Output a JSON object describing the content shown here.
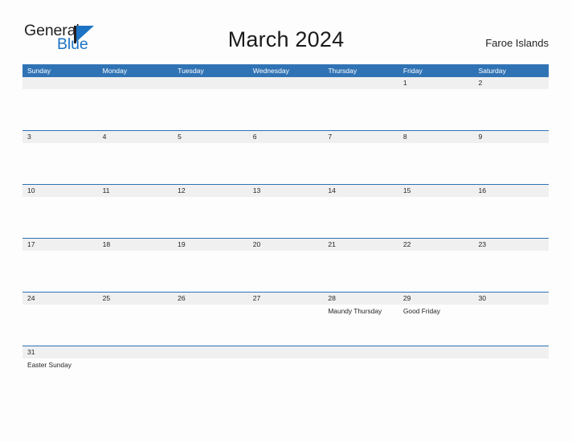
{
  "brand": {
    "name_part1": "General",
    "name_part2": "Blue",
    "flag_icon": "triangle-flag-icon",
    "accent_color": "#1c73c4"
  },
  "header": {
    "title": "March 2024",
    "region": "Faroe Islands"
  },
  "theme": {
    "header_blue": "#3073b5",
    "row_divider_blue": "#2e72b8",
    "date_band_gray": "#f0f0f0",
    "page_background": "#fdfdfd",
    "text_color": "#231f20"
  },
  "calendar": {
    "day_headers": [
      "Sunday",
      "Monday",
      "Tuesday",
      "Wednesday",
      "Thursday",
      "Friday",
      "Saturday"
    ],
    "weeks": [
      {
        "dates": [
          "",
          "",
          "",
          "",
          "",
          "1",
          "2"
        ],
        "events": [
          "",
          "",
          "",
          "",
          "",
          "",
          ""
        ]
      },
      {
        "dates": [
          "3",
          "4",
          "5",
          "6",
          "7",
          "8",
          "9"
        ],
        "events": [
          "",
          "",
          "",
          "",
          "",
          "",
          ""
        ]
      },
      {
        "dates": [
          "10",
          "11",
          "12",
          "13",
          "14",
          "15",
          "16"
        ],
        "events": [
          "",
          "",
          "",
          "",
          "",
          "",
          ""
        ]
      },
      {
        "dates": [
          "17",
          "18",
          "19",
          "20",
          "21",
          "22",
          "23"
        ],
        "events": [
          "",
          "",
          "",
          "",
          "",
          "",
          ""
        ]
      },
      {
        "dates": [
          "24",
          "25",
          "26",
          "27",
          "28",
          "29",
          "30"
        ],
        "events": [
          "",
          "",
          "",
          "",
          "Maundy Thursday",
          "Good Friday",
          ""
        ]
      },
      {
        "dates": [
          "31",
          "",
          "",
          "",
          "",
          "",
          ""
        ],
        "events": [
          "Easter Sunday",
          "",
          "",
          "",
          "",
          "",
          ""
        ]
      }
    ]
  }
}
